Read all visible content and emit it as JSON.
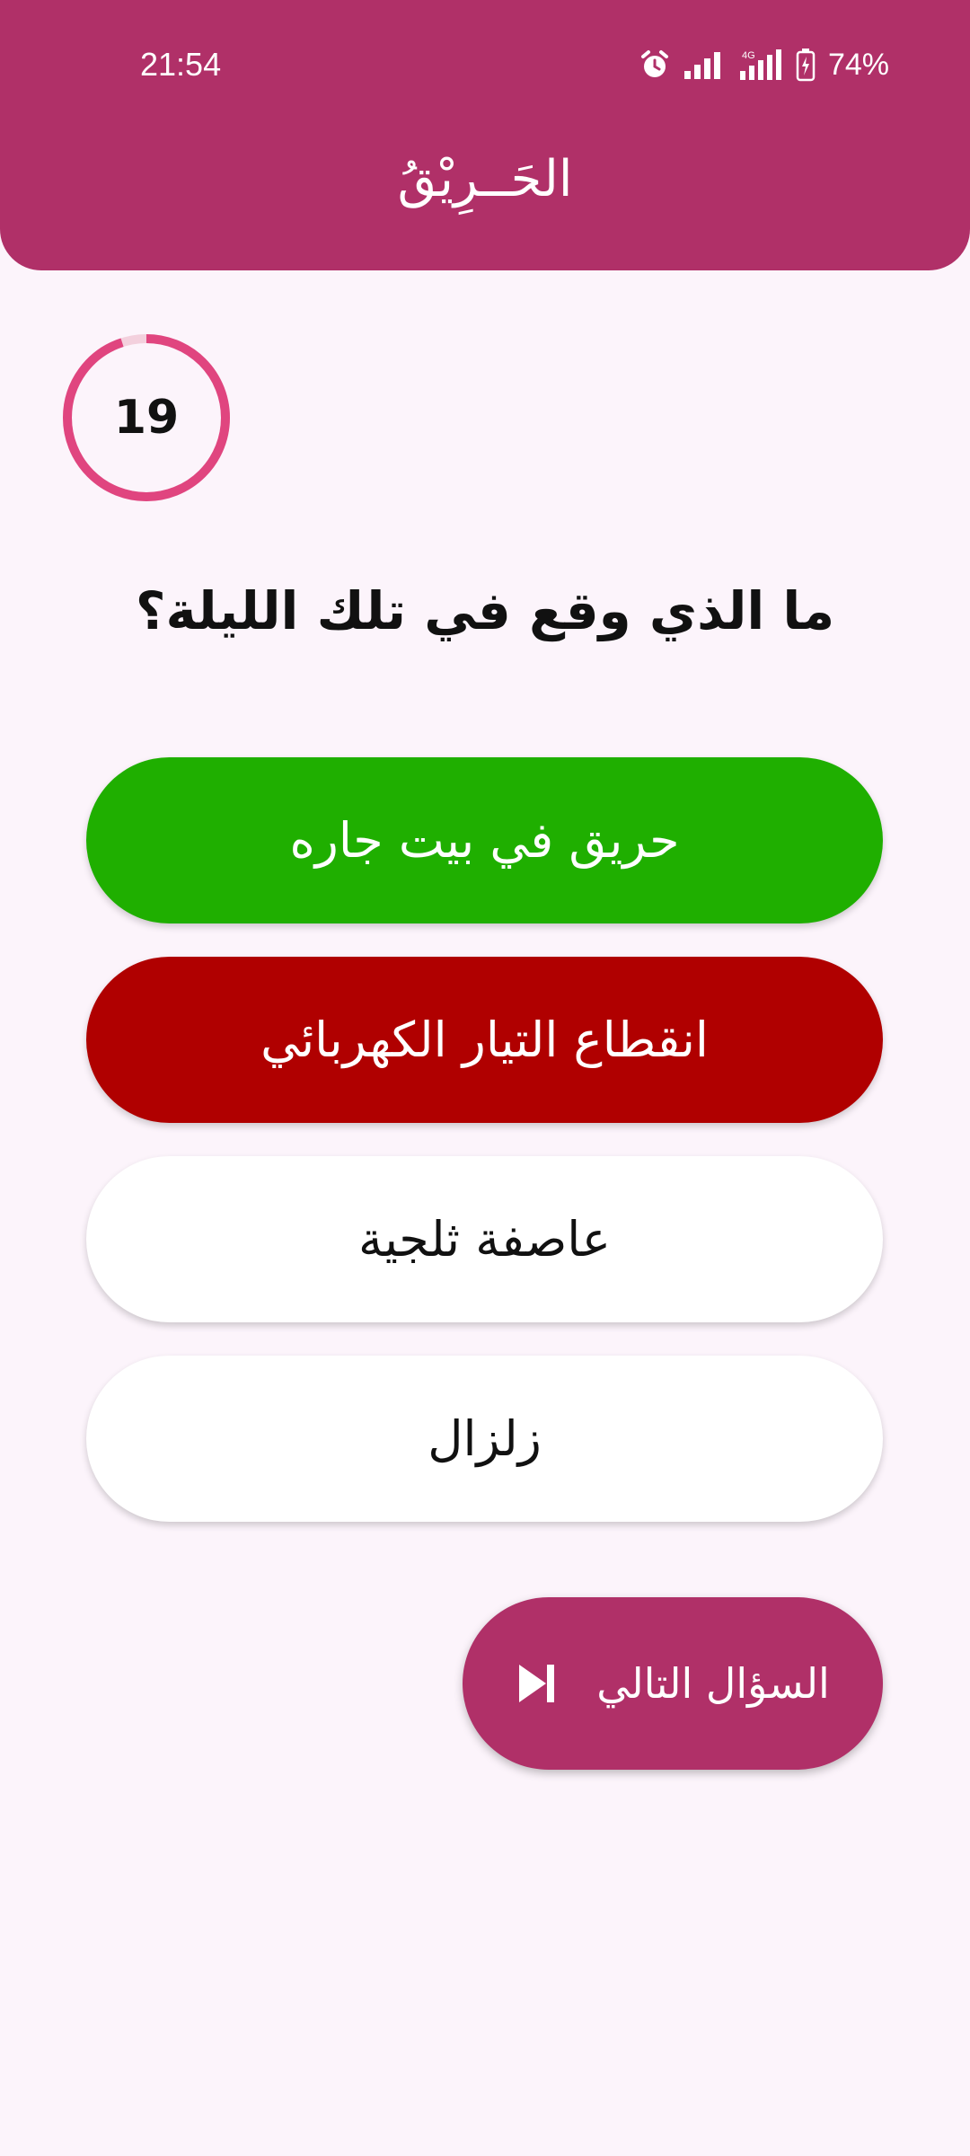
{
  "status_bar": {
    "time": "21:54",
    "battery_percent": "74%",
    "network_type": "4G",
    "icons": [
      "alarm-icon",
      "signal-icon",
      "4g-signal-icon",
      "battery-charging-icon"
    ]
  },
  "header": {
    "title": "الحَــرِيْقُ"
  },
  "timer": {
    "value": "19",
    "progress_fraction": 0.95
  },
  "question": {
    "text": "ما الذي وقع في تلك الليلة؟"
  },
  "answers": [
    {
      "label": "حريق في بيت جاره",
      "state": "correct"
    },
    {
      "label": "انقطاع التيار الكهربائي",
      "state": "wrong"
    },
    {
      "label": "عاصفة ثلجية",
      "state": "neutral"
    },
    {
      "label": "زلزال",
      "state": "neutral"
    }
  ],
  "next_button": {
    "label": "السؤال التالي",
    "icon": "skip-next-icon"
  },
  "colors": {
    "primary": "#b03068",
    "correct": "#1faf00",
    "wrong": "#b00000",
    "timer_ring": "#e0457f",
    "background": "#fcf4fb"
  }
}
